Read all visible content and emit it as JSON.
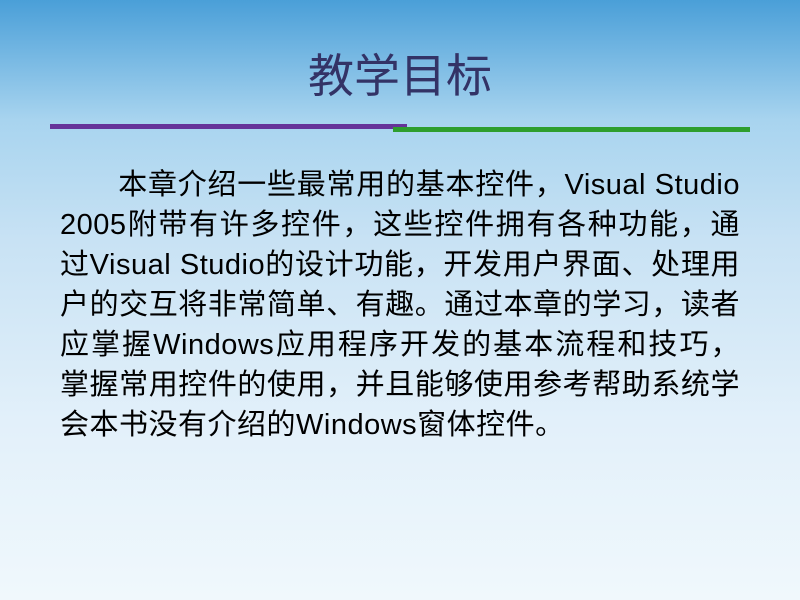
{
  "slide": {
    "title": "教学目标",
    "body": "本章介绍一些最常用的基本控件，Visual Studio 2005附带有许多控件，这些控件拥有各种功能，通过Visual Studio的设计功能，开发用户界面、处理用户的交互将非常简单、有趣。通过本章的学习，读者应掌握Windows应用程序开发的基本流程和技巧，掌握常用控件的使用，并且能够使用参考帮助系统学会本书没有介绍的Windows窗体控件。"
  },
  "colors": {
    "title_color": "#333366",
    "divider_purple": "#663399",
    "divider_green": "#2e9e2e",
    "gradient_top": "#4a9fd8",
    "gradient_bottom": "#f0f8fc"
  }
}
